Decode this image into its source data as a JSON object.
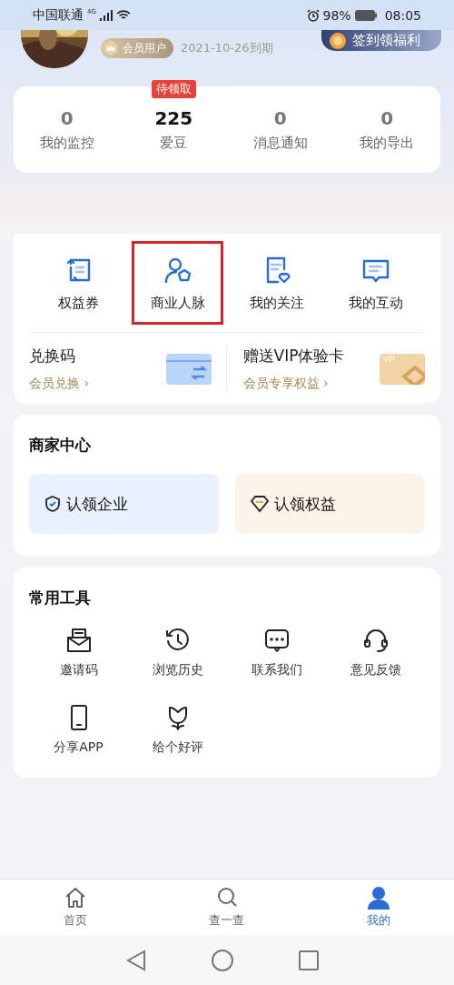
{
  "status_bar": {
    "carrier": "中国联通",
    "network": "4G",
    "battery": "98%",
    "time": "08:05"
  },
  "profile": {
    "badge": "会员用户",
    "expiry": "2021-10-26到期",
    "checkin": "签到领福利"
  },
  "stats": [
    {
      "value": "0",
      "label": "我的监控",
      "emphasis": false
    },
    {
      "value": "225",
      "label": "爱豆",
      "emphasis": true,
      "tag": "待领取"
    },
    {
      "value": "0",
      "label": "消息通知",
      "emphasis": false
    },
    {
      "value": "0",
      "label": "我的导出",
      "emphasis": false
    }
  ],
  "features": [
    {
      "label": "权益券",
      "highlighted": false
    },
    {
      "label": "商业人脉",
      "highlighted": true
    },
    {
      "label": "我的关注",
      "highlighted": false
    },
    {
      "label": "我的互动",
      "highlighted": false
    }
  ],
  "promos": [
    {
      "title": "兑换码",
      "link": "会员兑换",
      "arrow": "›",
      "kind": "exchange"
    },
    {
      "title": "赠送VIP体验卡",
      "link": "会员专享权益",
      "arrow": "›",
      "kind": "vip",
      "card_text": "VIP"
    }
  ],
  "merchant": {
    "title": "商家中心",
    "buttons": [
      {
        "label": "认领企业",
        "kind": "company"
      },
      {
        "label": "认领权益",
        "kind": "rights"
      }
    ]
  },
  "tools": {
    "title": "常用工具",
    "items": [
      {
        "label": "邀请码"
      },
      {
        "label": "浏览历史"
      },
      {
        "label": "联系我们"
      },
      {
        "label": "意见反馈"
      },
      {
        "label": "分享APP"
      },
      {
        "label": "给个好评"
      }
    ]
  },
  "tab_bar": [
    {
      "label": "首页",
      "selected": false
    },
    {
      "label": "查一查",
      "selected": false
    },
    {
      "label": "我的",
      "selected": true
    }
  ]
}
